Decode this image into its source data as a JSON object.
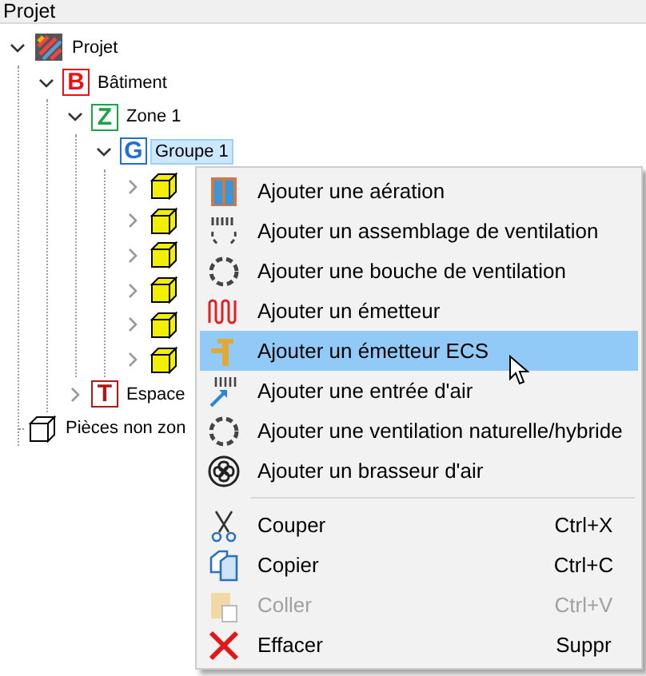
{
  "panel": {
    "title": "Projet"
  },
  "tree": [
    {
      "kind": "project",
      "label": "Projet",
      "expanded": true,
      "selected": false,
      "children": [
        {
          "kind": "building",
          "badge": "B",
          "label": "Bâtiment",
          "expanded": true,
          "selected": false,
          "children": [
            {
              "kind": "zone",
              "badge": "Z",
              "label": "Zone 1",
              "expanded": true,
              "selected": false,
              "children": [
                {
                  "kind": "group",
                  "badge": "G",
                  "label": "Groupe 1",
                  "expanded": true,
                  "selected": true,
                  "children": [
                    {
                      "kind": "room",
                      "expanded": false,
                      "selected": false
                    },
                    {
                      "kind": "room",
                      "expanded": false,
                      "selected": false
                    },
                    {
                      "kind": "room",
                      "expanded": false,
                      "selected": false
                    },
                    {
                      "kind": "room",
                      "expanded": false,
                      "selected": false
                    },
                    {
                      "kind": "room",
                      "expanded": false,
                      "selected": false
                    },
                    {
                      "kind": "room",
                      "expanded": false,
                      "selected": false
                    }
                  ]
                }
              ]
            },
            {
              "kind": "space",
              "badge": "T",
              "label": "Espace",
              "expanded": false,
              "selected": false
            }
          ]
        },
        {
          "kind": "unzoned",
          "label": "Pièces non zon",
          "selected": false
        }
      ]
    }
  ],
  "context_menu": {
    "sections": [
      {
        "items": [
          {
            "kind": "aeration",
            "label": "Ajouter une aération",
            "selected": false,
            "disabled": false
          },
          {
            "kind": "assembly",
            "label": "Ajouter un assemblage de ventilation",
            "selected": false,
            "disabled": false
          },
          {
            "kind": "vent",
            "label": "Ajouter une bouche de ventilation",
            "selected": false,
            "disabled": false
          },
          {
            "kind": "emitter",
            "label": "Ajouter un émetteur",
            "selected": false,
            "disabled": false
          },
          {
            "kind": "hotwater",
            "label": "Ajouter un émetteur ECS",
            "selected": true,
            "disabled": false
          },
          {
            "kind": "inlet",
            "label": "Ajouter une entrée d'air",
            "selected": false,
            "disabled": false
          },
          {
            "kind": "vent",
            "label": "Ajouter une ventilation naturelle/hybride",
            "selected": false,
            "disabled": false
          },
          {
            "kind": "fan",
            "label": "Ajouter un brasseur d'air",
            "selected": false,
            "disabled": false
          }
        ]
      },
      {
        "items": [
          {
            "kind": "cut",
            "label": "Couper",
            "shortcut": "Ctrl+X",
            "selected": false,
            "disabled": false
          },
          {
            "kind": "copy",
            "label": "Copier",
            "shortcut": "Ctrl+C",
            "selected": false,
            "disabled": false
          },
          {
            "kind": "paste",
            "label": "Coller",
            "shortcut": "Ctrl+V",
            "selected": false,
            "disabled": true
          },
          {
            "kind": "delete",
            "label": "Effacer",
            "shortcut": "Suppr",
            "selected": false,
            "disabled": false
          }
        ]
      }
    ]
  }
}
